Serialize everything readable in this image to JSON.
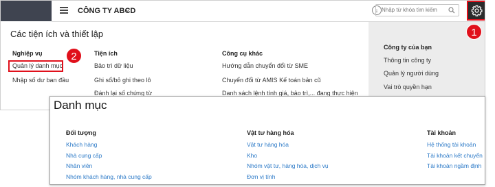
{
  "topbar": {
    "company_name": "CÔNG TY ABCD",
    "search_placeholder": "Nhập từ khóa tìm kiếm"
  },
  "settings_panel": {
    "title": "Các tiện ích và thiết lập",
    "columns": [
      {
        "title": "Nghiệp vụ",
        "items": [
          "Quản lý danh mục",
          "Nhập số dư ban đầu"
        ]
      },
      {
        "title": "Tiện ích",
        "items": [
          "Bảo trì dữ liệu",
          "Ghi sổ/bỏ ghi theo lô",
          "Đánh lại số chứng từ"
        ]
      },
      {
        "title": "Công cụ khác",
        "items": [
          "Hướng dẫn chuyển đổi từ SME",
          "Chuyển đổi từ AMIS Kế toán bản cũ",
          "Danh sách lệnh tính giá, bảo trì,... đang thực hiện"
        ]
      }
    ],
    "company_section": {
      "title": "Công ty của bạn",
      "items": [
        "Thông tin công ty",
        "Quản lý người dùng",
        "Vai trò quyền hạn"
      ]
    }
  },
  "badges": {
    "step1": "1",
    "step2": "2"
  },
  "danh_muc": {
    "title": "Danh mục",
    "columns": [
      {
        "title": "Đối tượng",
        "items": [
          "Khách hàng",
          "Nhà cung cấp",
          "Nhân viên",
          "Nhóm khách hàng, nhà cung cấp"
        ]
      },
      {
        "title": "Vật tư hàng hóa",
        "items": [
          "Vật tư hàng hóa",
          "Kho",
          "Nhóm vật tư, hàng hóa, dịch vụ",
          "Đơn vị tính"
        ]
      },
      {
        "title": "Tài khoản",
        "items": [
          "Hệ thống tài khoản",
          "Tài khoản kết chuyển",
          "Tài khoản ngầm định"
        ]
      }
    ]
  },
  "colors": {
    "highlight": "#e0101b",
    "link": "#2b79c7",
    "dark_bar": "#3f4450"
  }
}
